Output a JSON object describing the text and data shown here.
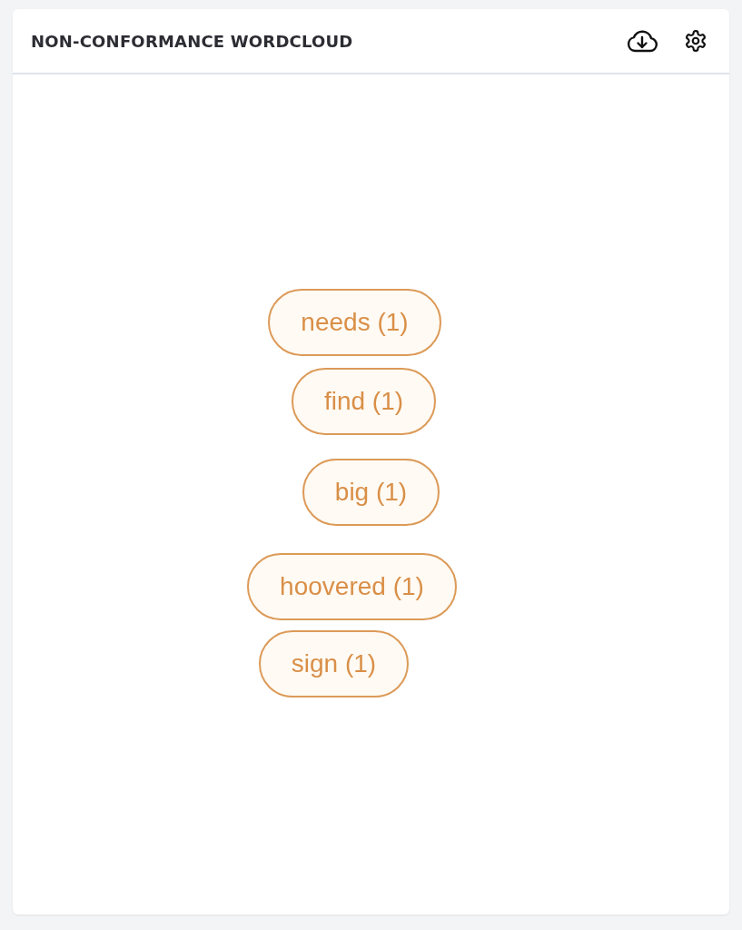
{
  "panel": {
    "title": "NON-CONFORMANCE WORDCLOUD"
  },
  "words": [
    {
      "label": "needs (1)"
    },
    {
      "label": "find (1)"
    },
    {
      "label": "big (1)"
    },
    {
      "label": "hoovered (1)"
    },
    {
      "label": "sign (1)"
    }
  ]
}
